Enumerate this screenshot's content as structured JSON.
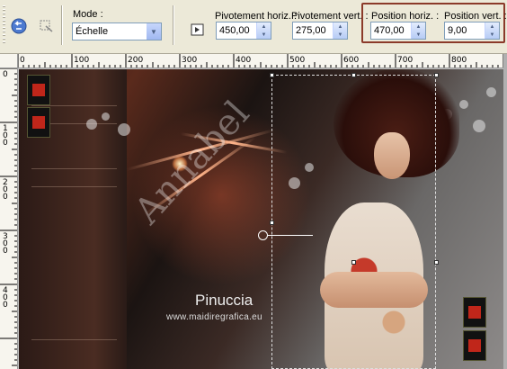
{
  "toolbar": {
    "mode_label": "Mode :",
    "mode_value": "Échelle",
    "pivot_h_label": "Pivotement horiz. :",
    "pivot_h_value": "450,00",
    "pivot_v_label": "Pivotement vert. :",
    "pivot_v_value": "275,00",
    "pos_h_label": "Position horiz. :",
    "pos_h_value": "470,00",
    "pos_v_label": "Position vert. :",
    "pos_v_value": "9,00",
    "icons": [
      "apply-icon",
      "pick-icon",
      "fit-icon"
    ]
  },
  "rulers": {
    "top": [
      "0",
      "100",
      "200",
      "300",
      "400",
      "500",
      "600",
      "700",
      "800"
    ],
    "left": [
      "0",
      "1 0 0",
      "2 0 0",
      "3 0 0",
      "4 0 0"
    ]
  },
  "watermark": {
    "diagonal": "Annabel",
    "name": "Pinuccia",
    "url": "www.maidiregrafica.eu"
  },
  "colors": {
    "highlight": "#8b3a2a",
    "toolbar_bg": "#ece9d8",
    "field_border": "#7f9db9"
  }
}
